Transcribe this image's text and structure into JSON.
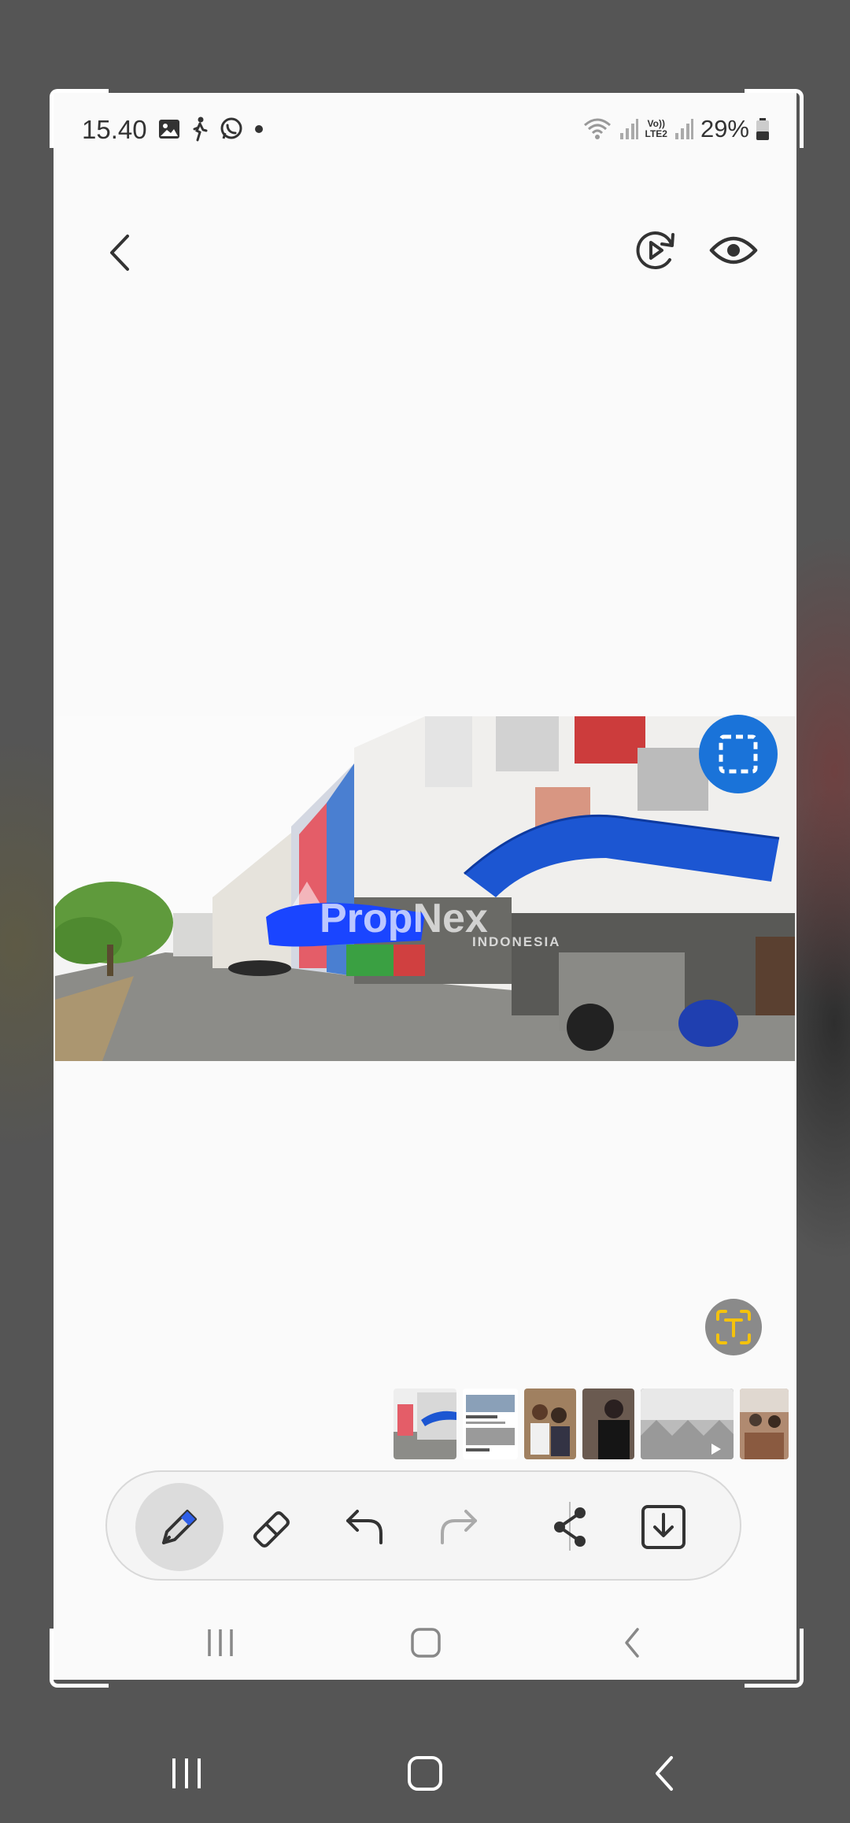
{
  "status_bar": {
    "time": "15.40",
    "battery": "29%",
    "network_label": "LTE2",
    "icons": [
      "gallery-icon",
      "activity-icon",
      "whatsapp-icon",
      "dot-icon",
      "wifi-icon",
      "signal-icon",
      "volte-icon",
      "signal-icon",
      "battery-icon"
    ]
  },
  "toolbar": {
    "back": "back-icon",
    "replay": "replay-icon",
    "view": "eye-icon"
  },
  "image": {
    "watermark_brand": "PropNex",
    "watermark_sub": "INDONESIA"
  },
  "thumbnails": [
    "street-photo",
    "listing-screenshot",
    "group-photo",
    "person-photo",
    "tiled-floor-photo",
    "restaurant-photo"
  ],
  "edit_tools": [
    "pen",
    "eraser",
    "undo",
    "redo",
    "share",
    "save"
  ],
  "colors": {
    "accent": "#1a73d9",
    "pen_tip": "#2f5fe8",
    "text_icon": "#f4c20d"
  }
}
